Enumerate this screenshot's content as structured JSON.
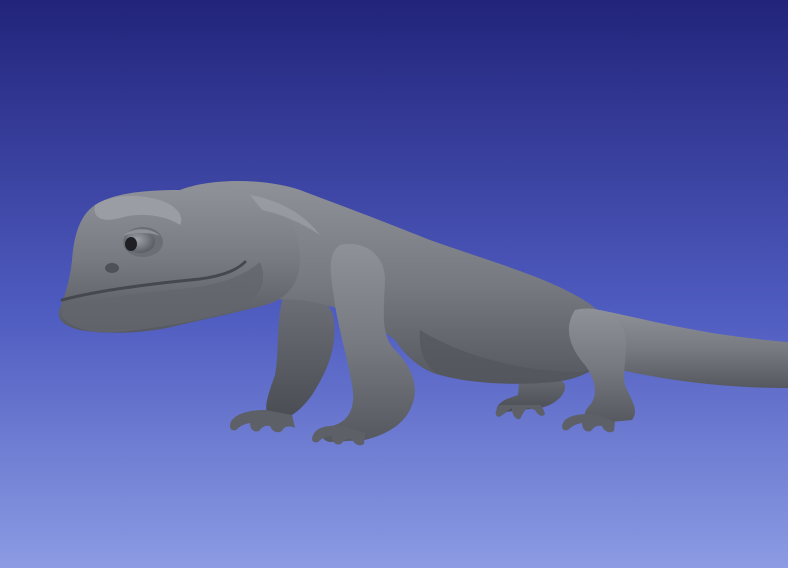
{
  "viewport": {
    "background_top": "#22247a",
    "background_bottom": "#8c9be3",
    "model_color": "#7a7d84"
  }
}
